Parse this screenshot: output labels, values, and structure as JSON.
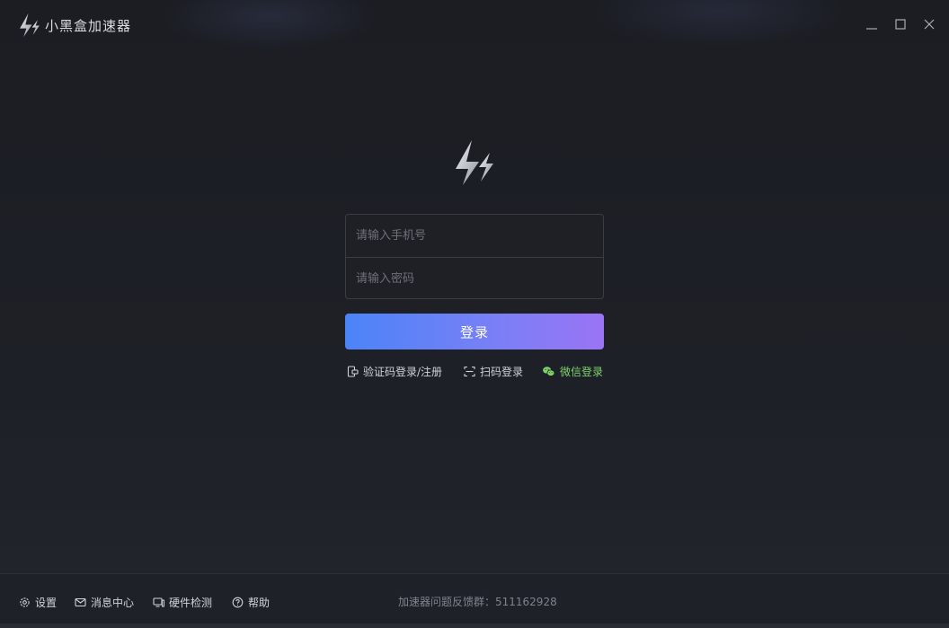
{
  "window": {
    "title": "小黑盒加速器",
    "controls": {
      "minimize_icon": "minimize-icon",
      "maximize_icon": "maximize-icon",
      "close_icon": "close-icon"
    }
  },
  "login": {
    "phone_placeholder": "请输入手机号",
    "password_placeholder": "请输入密码",
    "login_label": "登录",
    "alt_options": {
      "code_login": "验证码登录/注册",
      "scan_login": "扫码登录",
      "wechat_login": "微信登录"
    }
  },
  "footer": {
    "settings": "设置",
    "messages": "消息中心",
    "hardware": "硬件检测",
    "help": "帮助",
    "feedback": "加速器问题反馈群：511162928"
  },
  "colors": {
    "background": "#1c1e24",
    "button_gradient_start": "#4b84f7",
    "button_gradient_end": "#9a74f4",
    "wechat_green": "#7fd36b"
  }
}
